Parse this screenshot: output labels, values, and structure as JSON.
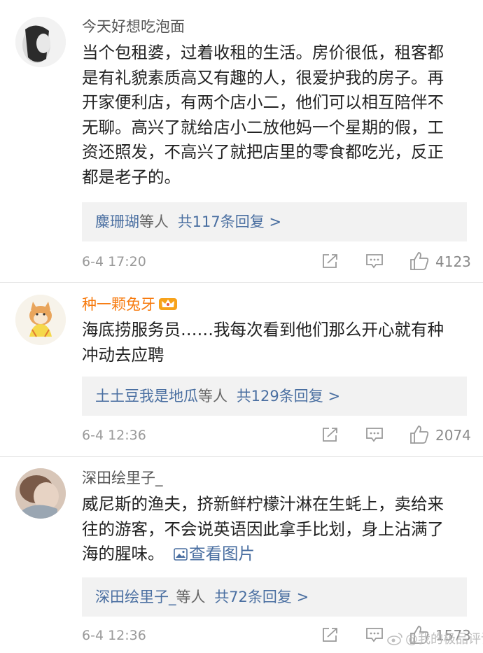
{
  "comments": [
    {
      "username": "今天好想吃泡面",
      "lines": [
        "当个包租婆，过着收租的生活。房价很低，租客都",
        "是有礼貌素质高又有趣的人，很爱护我的房子。再",
        "开家便利店，有两个店小二，他们可以相互陪伴不",
        "无聊。高兴了就给店小二放他妈一个星期的假，工",
        "资还照发，不高兴了就把店里的零食都吃光，反正",
        "都是老子的。"
      ],
      "reply_user": "麋珊瑚",
      "reply_mid": "等人",
      "reply_count": "共117条回复 >",
      "time": "6-4 17:20",
      "likes": "4123"
    },
    {
      "username": "种一颗兔牙",
      "lines": [
        "海底捞服务员……我每次看到他们那么开心就有种",
        "冲动去应聘"
      ],
      "reply_user": "土土豆我是地瓜",
      "reply_mid": "等人",
      "reply_count": "共129条回复 >",
      "time": "6-4 12:36",
      "likes": "2074"
    },
    {
      "username": "深田绘里子_",
      "lines": [
        "威尼斯的渔夫，挤新鲜柠檬汁淋在生蚝上，卖给来",
        "往的游客，不会说英语因此拿手比划，身上沾满了",
        "海的腥味。"
      ],
      "image_link": "查看图片",
      "reply_user": "深田绘里子_",
      "reply_mid": "等人",
      "reply_count": "共72条回复 >",
      "time": "6-4 12:36",
      "likes": "1573"
    }
  ],
  "watermark": "@我的极品评论",
  "colors": {
    "link": "#4a6fa1",
    "vip_name": "#f77b0f",
    "reply_bg": "#f2f2f2"
  },
  "icons": [
    "share-icon",
    "comment-icon",
    "like-icon",
    "crown-badge-icon",
    "image-icon",
    "weibo-logo-icon"
  ]
}
